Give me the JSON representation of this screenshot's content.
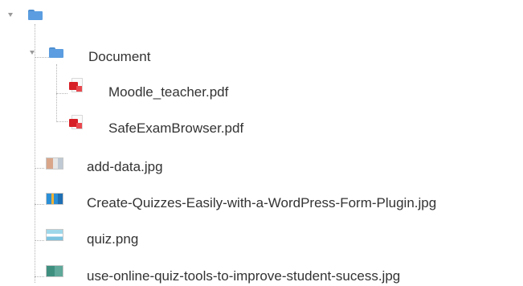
{
  "tree": {
    "root": {
      "folder_icon": "folder-icon",
      "toggle_icon": "caret-down-icon"
    },
    "document_folder": {
      "label": "Document",
      "folder_icon": "folder-icon",
      "toggle_icon": "caret-down-icon",
      "files": [
        {
          "label": "Moodle_teacher.pdf",
          "icon": "pdf-icon"
        },
        {
          "label": "SafeExamBrowser.pdf",
          "icon": "pdf-icon"
        }
      ]
    },
    "files": [
      {
        "label": "add-data.jpg",
        "icon": "image-thumbnail-icon"
      },
      {
        "label": "Create-Quizzes-Easily-with-a-WordPress-Form-Plugin.jpg",
        "icon": "image-thumbnail-icon"
      },
      {
        "label": "quiz.png",
        "icon": "image-thumbnail-icon"
      },
      {
        "label": "use-online-quiz-tools-to-improve-student-sucess.jpg",
        "icon": "image-thumbnail-icon"
      }
    ]
  },
  "colors": {
    "folder": "#5b9de0",
    "pdf": "#d61f26",
    "text": "#333333",
    "connector": "#b3b3b3"
  }
}
